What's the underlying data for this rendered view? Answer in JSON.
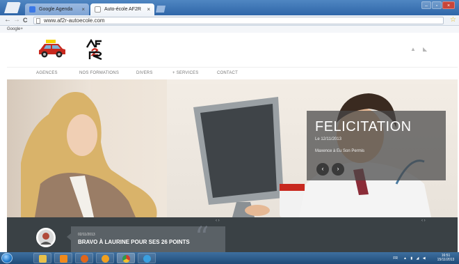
{
  "browser": {
    "tabs": [
      {
        "label": "Google Agenda",
        "close": "×",
        "favicon_color": "#3b78e7"
      },
      {
        "label": "Auto-école AF2R",
        "close": "×",
        "favicon_color": "#ffffff"
      }
    ],
    "window_buttons": {
      "minimize": "–",
      "maximize": "▫",
      "close": "×"
    },
    "nav": {
      "back": "←",
      "forward": "→",
      "reload": "C"
    },
    "address": "www.af2r-autoecole.com",
    "star": "☆",
    "bookmarks": [
      "Google+"
    ]
  },
  "site": {
    "social_icons": [
      "thumbs-up-icon",
      "twitter-bird-icon"
    ],
    "nav": [
      "AGENCES",
      "NOS FORMATIONS",
      "DIVERS",
      "+ SERVICES",
      "CONTACT"
    ],
    "slide": {
      "title": "FELICITATION",
      "date": "Le 12/11/2013",
      "text": "Maxence à Eu Son Permis",
      "prev": "‹",
      "next": "›"
    },
    "news": {
      "date": "02/11/2013",
      "title": "BRAVO À LAURINE POUR SES 26 POINTS",
      "quote": "“"
    },
    "colors": {
      "caption_bg": "#464646",
      "strip_bg": "#3a4145",
      "car_red": "#c8281e",
      "logo_red": "#c8281e"
    }
  },
  "taskbar": {
    "pinned": [
      {
        "name": "explorer",
        "color": "#e8c04a"
      },
      {
        "name": "outlook",
        "color": "#f08a1c"
      },
      {
        "name": "firefox",
        "color": "#e0661b"
      },
      {
        "name": "media-player",
        "color": "#f0a020"
      },
      {
        "name": "chrome",
        "color": "#d23d2d"
      },
      {
        "name": "network",
        "color": "#3aa0e0"
      }
    ],
    "lang": "FR",
    "time": "16:51",
    "date": "15/11/2013"
  }
}
